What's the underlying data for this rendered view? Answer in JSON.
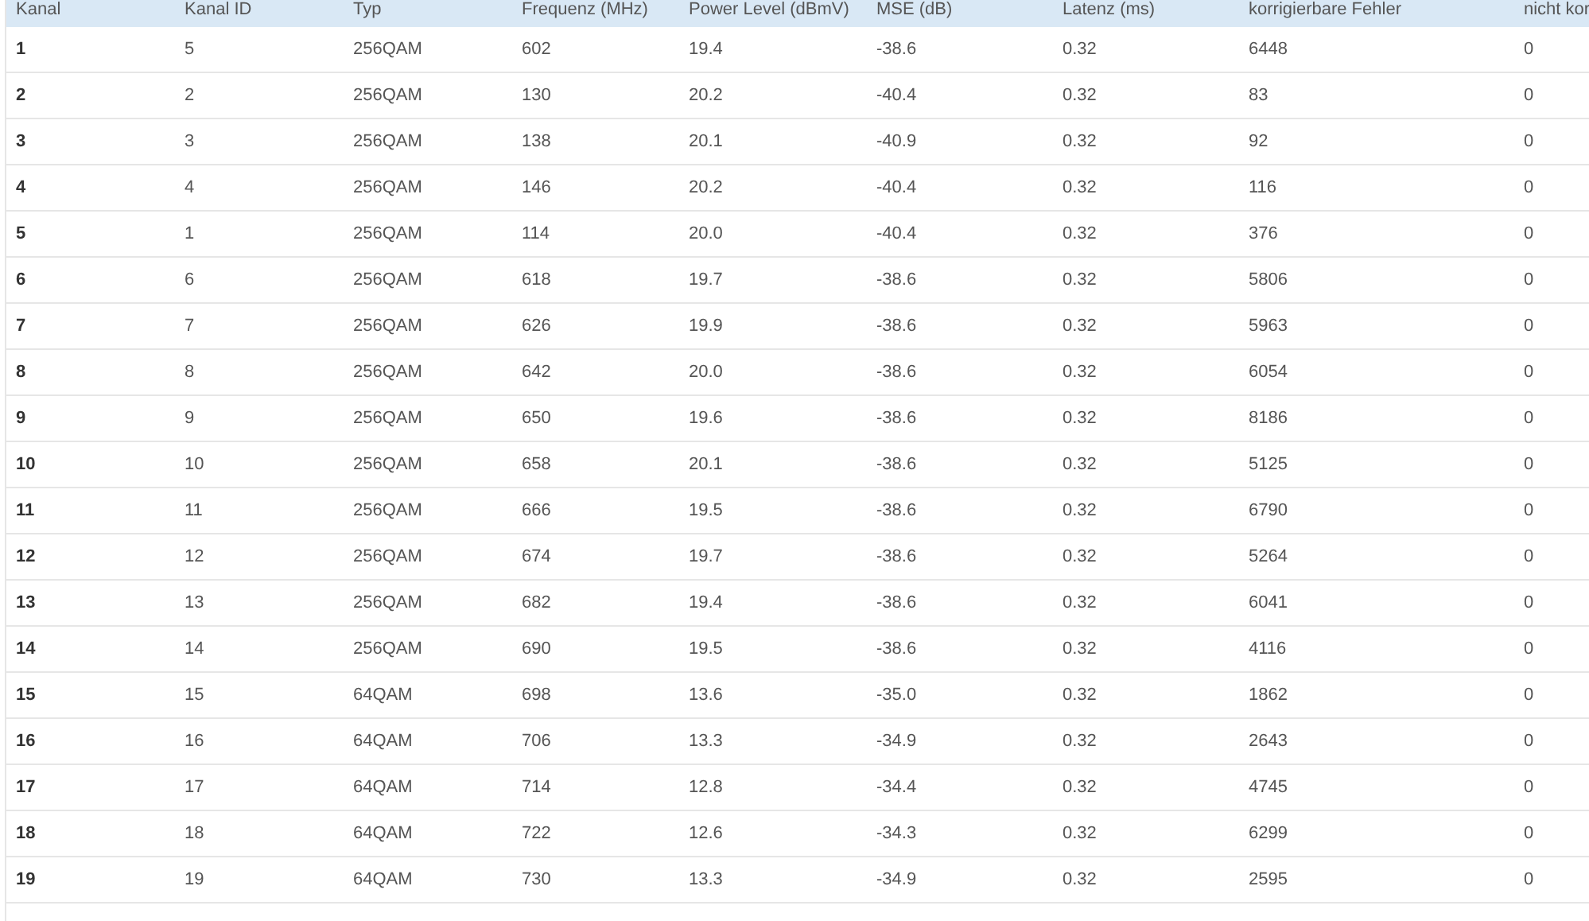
{
  "table": {
    "columns": [
      "Kanal",
      "Kanal ID",
      "Typ",
      "Frequenz (MHz)",
      "Power Level (dBmV)",
      "MSE (dB)",
      "Latenz (ms)",
      "korrigierbare Fehler",
      "nicht kor"
    ],
    "rows": [
      [
        "1",
        "5",
        "256QAM",
        "602",
        "19.4",
        "-38.6",
        "0.32",
        "6448",
        "0"
      ],
      [
        "2",
        "2",
        "256QAM",
        "130",
        "20.2",
        "-40.4",
        "0.32",
        "83",
        "0"
      ],
      [
        "3",
        "3",
        "256QAM",
        "138",
        "20.1",
        "-40.9",
        "0.32",
        "92",
        "0"
      ],
      [
        "4",
        "4",
        "256QAM",
        "146",
        "20.2",
        "-40.4",
        "0.32",
        "116",
        "0"
      ],
      [
        "5",
        "1",
        "256QAM",
        "114",
        "20.0",
        "-40.4",
        "0.32",
        "376",
        "0"
      ],
      [
        "6",
        "6",
        "256QAM",
        "618",
        "19.7",
        "-38.6",
        "0.32",
        "5806",
        "0"
      ],
      [
        "7",
        "7",
        "256QAM",
        "626",
        "19.9",
        "-38.6",
        "0.32",
        "5963",
        "0"
      ],
      [
        "8",
        "8",
        "256QAM",
        "642",
        "20.0",
        "-38.6",
        "0.32",
        "6054",
        "0"
      ],
      [
        "9",
        "9",
        "256QAM",
        "650",
        "19.6",
        "-38.6",
        "0.32",
        "8186",
        "0"
      ],
      [
        "10",
        "10",
        "256QAM",
        "658",
        "20.1",
        "-38.6",
        "0.32",
        "5125",
        "0"
      ],
      [
        "11",
        "11",
        "256QAM",
        "666",
        "19.5",
        "-38.6",
        "0.32",
        "6790",
        "0"
      ],
      [
        "12",
        "12",
        "256QAM",
        "674",
        "19.7",
        "-38.6",
        "0.32",
        "5264",
        "0"
      ],
      [
        "13",
        "13",
        "256QAM",
        "682",
        "19.4",
        "-38.6",
        "0.32",
        "6041",
        "0"
      ],
      [
        "14",
        "14",
        "256QAM",
        "690",
        "19.5",
        "-38.6",
        "0.32",
        "4116",
        "0"
      ],
      [
        "15",
        "15",
        "64QAM",
        "698",
        "13.6",
        "-35.0",
        "0.32",
        "1862",
        "0"
      ],
      [
        "16",
        "16",
        "64QAM",
        "706",
        "13.3",
        "-34.9",
        "0.32",
        "2643",
        "0"
      ],
      [
        "17",
        "17",
        "64QAM",
        "714",
        "12.8",
        "-34.4",
        "0.32",
        "4745",
        "0"
      ],
      [
        "18",
        "18",
        "64QAM",
        "722",
        "12.6",
        "-34.3",
        "0.32",
        "6299",
        "0"
      ],
      [
        "19",
        "19",
        "64QAM",
        "730",
        "13.3",
        "-34.9",
        "0.32",
        "2595",
        "0"
      ]
    ]
  }
}
